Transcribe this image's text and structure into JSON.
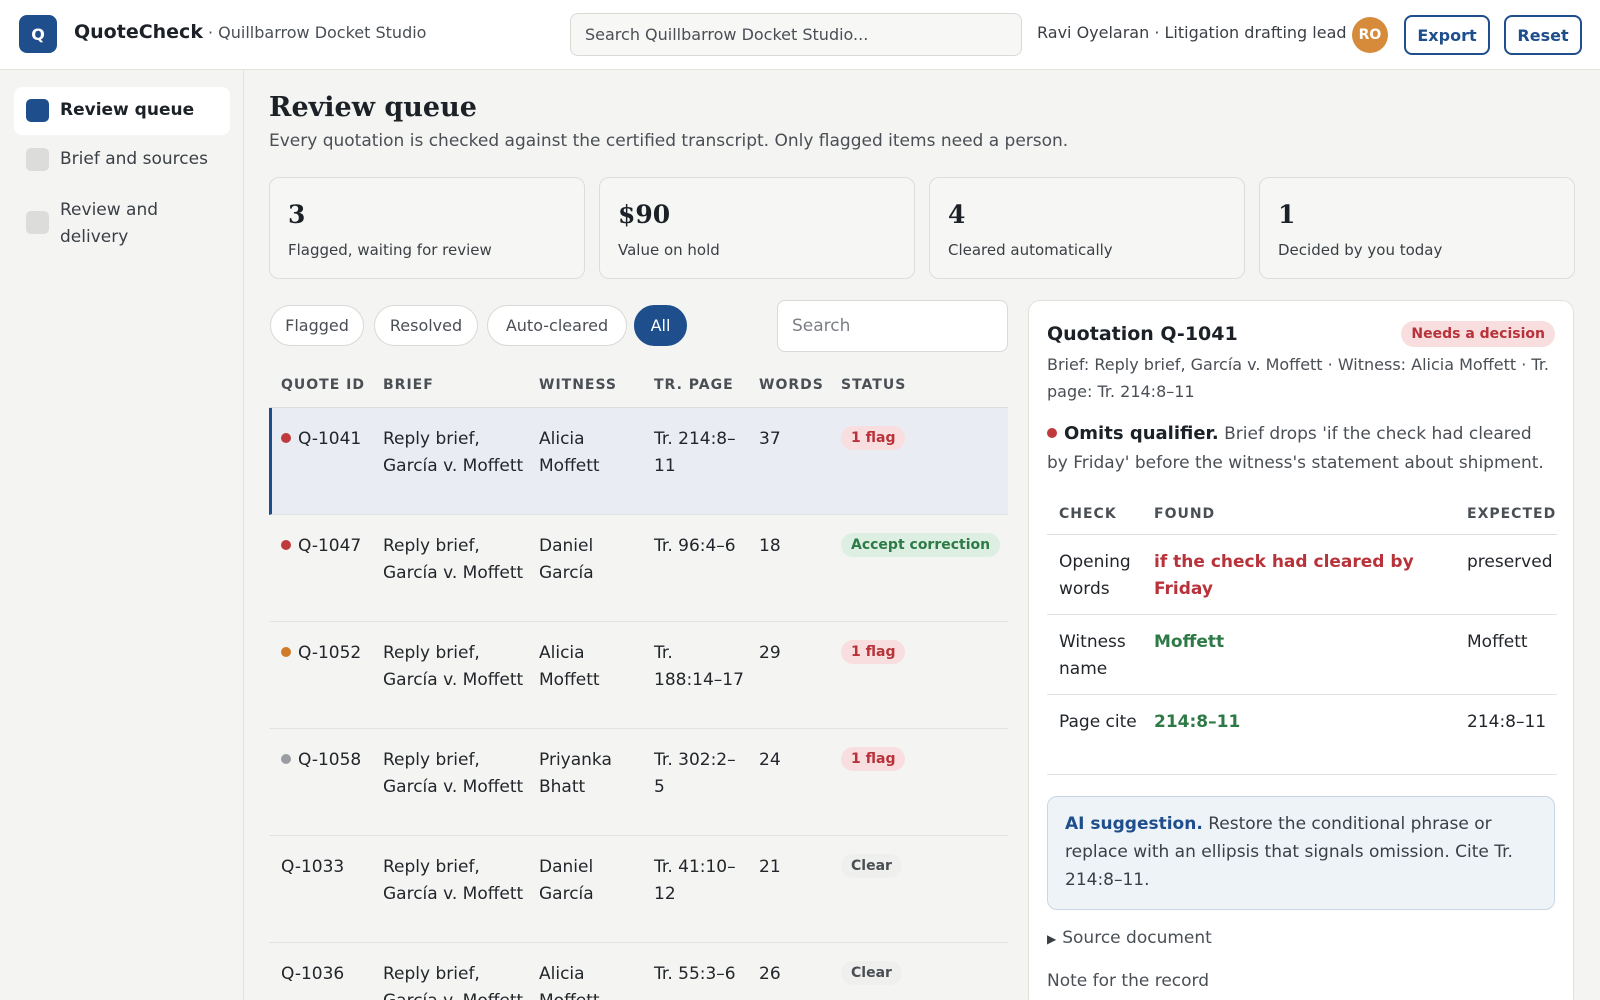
{
  "header": {
    "logo_letter": "Q",
    "app_name": "QuoteCheck",
    "workspace": "· Quillbarrow Docket Studio",
    "search_placeholder": "Search Quillbarrow Docket Studio...",
    "user": "Ravi Oyelaran · Litigation drafting lead",
    "avatar_initials": "RO",
    "export_label": "Export",
    "reset_label": "Reset"
  },
  "sidebar": {
    "items": [
      {
        "label": "Review queue",
        "active": true
      },
      {
        "label": "Brief and sources",
        "active": false
      },
      {
        "label": "Review and delivery",
        "active": false
      }
    ]
  },
  "main": {
    "title": "Review queue",
    "subtitle": "Every quotation is checked against the certified transcript. Only flagged items need a person.",
    "stats": [
      {
        "value": "3",
        "label": "Flagged, waiting for review"
      },
      {
        "value": "$90",
        "label": "Value on hold"
      },
      {
        "value": "4",
        "label": "Cleared automatically"
      },
      {
        "value": "1",
        "label": "Decided by you today"
      }
    ],
    "filters": [
      "Flagged",
      "Resolved",
      "Auto-cleared",
      "All"
    ],
    "active_filter": "All",
    "search_placeholder": "Search",
    "columns": [
      "QUOTE ID",
      "BRIEF",
      "WITNESS",
      "TR. PAGE",
      "WORDS",
      "STATUS"
    ],
    "rows": [
      {
        "id": "Q-1041",
        "dot": "#c0393b",
        "brief": "Reply brief, García v. Moffett",
        "witness": "Alicia Moffett",
        "page": "Tr. 214:8–11",
        "words": "37",
        "status": "1 flag",
        "status_type": "flag",
        "selected": true
      },
      {
        "id": "Q-1047",
        "dot": "#c0393b",
        "brief": "Reply brief, García v. Moffett",
        "witness": "Daniel García",
        "page": "Tr. 96:4–6",
        "words": "18",
        "status": "Accept correction",
        "status_type": "accept",
        "selected": false
      },
      {
        "id": "Q-1052",
        "dot": "#d07a2a",
        "brief": "Reply brief, García v. Moffett",
        "witness": "Alicia Moffett",
        "page": "Tr. 188:14–17",
        "words": "29",
        "status": "1 flag",
        "status_type": "flag",
        "selected": false
      },
      {
        "id": "Q-1058",
        "dot": "#9a9ea3",
        "brief": "Reply brief, García v. Moffett",
        "witness": "Priyanka Bhatt",
        "page": "Tr. 302:2–5",
        "words": "24",
        "status": "1 flag",
        "status_type": "flag",
        "selected": false
      },
      {
        "id": "Q-1033",
        "dot": "",
        "brief": "Reply brief, García v. Moffett",
        "witness": "Daniel García",
        "page": "Tr. 41:10–12",
        "words": "21",
        "status": "Clear",
        "status_type": "clear",
        "selected": false
      },
      {
        "id": "Q-1036",
        "dot": "",
        "brief": "Reply brief, García v. Moffett",
        "witness": "Alicia Moffett",
        "page": "Tr. 55:3–6",
        "words": "26",
        "status": "Clear",
        "status_type": "clear",
        "selected": false
      }
    ]
  },
  "detail": {
    "title": "Quotation Q-1041",
    "badge": "Needs a decision",
    "meta": "Brief: Reply brief, García v. Moffett · Witness: Alicia Moffett · Tr. page: Tr. 214:8–11",
    "issue_title": "Omits qualifier.",
    "issue_text": "Brief drops 'if the check had cleared by Friday' before the witness's statement about shipment.",
    "issue_dot": "#c0393b",
    "columns": [
      "CHECK",
      "FOUND",
      "EXPECTED"
    ],
    "checks": [
      {
        "check": "Opening words",
        "found": "if the check had cleared by Friday",
        "found_ok": false,
        "expected": "preserved"
      },
      {
        "check": "Witness name",
        "found": "Moffett",
        "found_ok": true,
        "expected": "Moffett"
      },
      {
        "check": "Page cite",
        "found": "214:8–11",
        "found_ok": true,
        "expected": "214:8–11"
      }
    ],
    "ai_label": "AI suggestion.",
    "ai_text": "Restore the conditional phrase or replace with an ellipsis that signals omission. Cite Tr. 214:8–11.",
    "source_label": "Source document",
    "note_label": "Note for the record"
  },
  "colors": {
    "accent": "#1f4e8c",
    "flag": "#b8323a",
    "ok": "#2e7a47"
  }
}
